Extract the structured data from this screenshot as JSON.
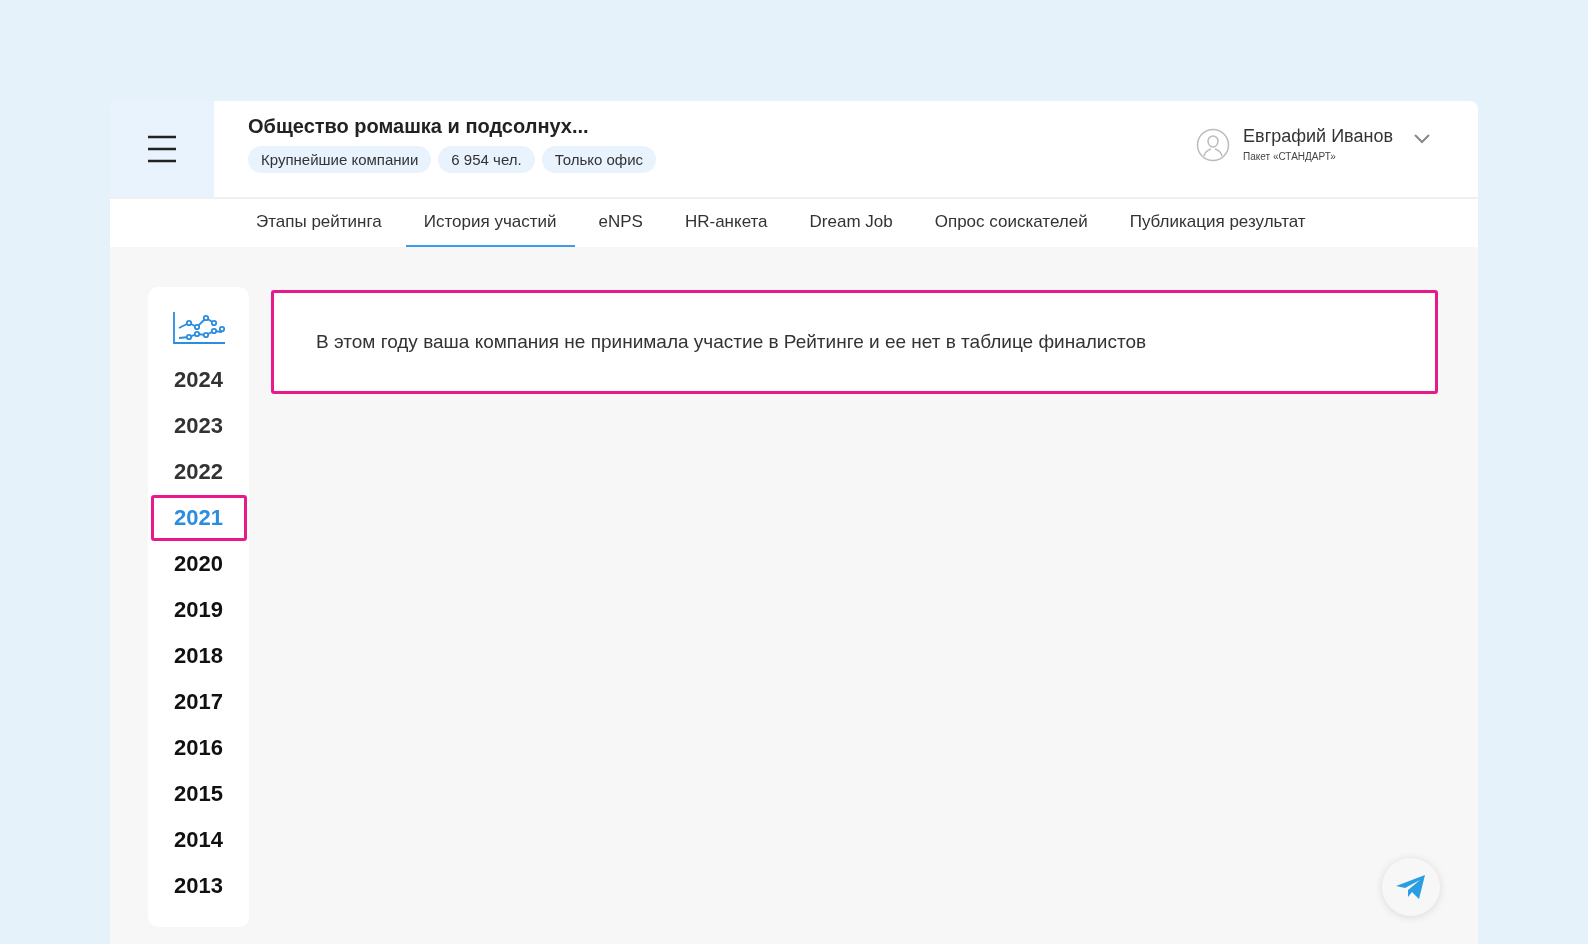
{
  "header": {
    "company": "Общество ромашка и подсолнух...",
    "tags": [
      "Крупнейшие компании",
      "6 954 чел.",
      "Только офис"
    ],
    "user": {
      "name": "Евграфий Иванов",
      "plan": "Пакет «СТАНДАРТ»"
    }
  },
  "tabs": [
    {
      "label": "Этапы рейтинга",
      "selected": false
    },
    {
      "label": "История участий",
      "selected": true
    },
    {
      "label": "eNPS",
      "selected": false
    },
    {
      "label": "HR-анкета",
      "selected": false
    },
    {
      "label": "Dream Job",
      "selected": false
    },
    {
      "label": "Опрос соискателей",
      "selected": false
    },
    {
      "label": "Публикация результат",
      "selected": false
    }
  ],
  "years": [
    {
      "label": "2024",
      "selected": false
    },
    {
      "label": "2023",
      "selected": false
    },
    {
      "label": "2022",
      "selected": false
    },
    {
      "label": "2021",
      "selected": true
    },
    {
      "label": "2020",
      "selected": false
    },
    {
      "label": "2019",
      "selected": false
    },
    {
      "label": "2018",
      "selected": false
    },
    {
      "label": "2017",
      "selected": false
    },
    {
      "label": "2016",
      "selected": false
    },
    {
      "label": "2015",
      "selected": false
    },
    {
      "label": "2014",
      "selected": false
    },
    {
      "label": "2013",
      "selected": false
    }
  ],
  "message": "В этом году ваша компания не принимала участие в Рейтинге и ее нет в таблице финалистов"
}
